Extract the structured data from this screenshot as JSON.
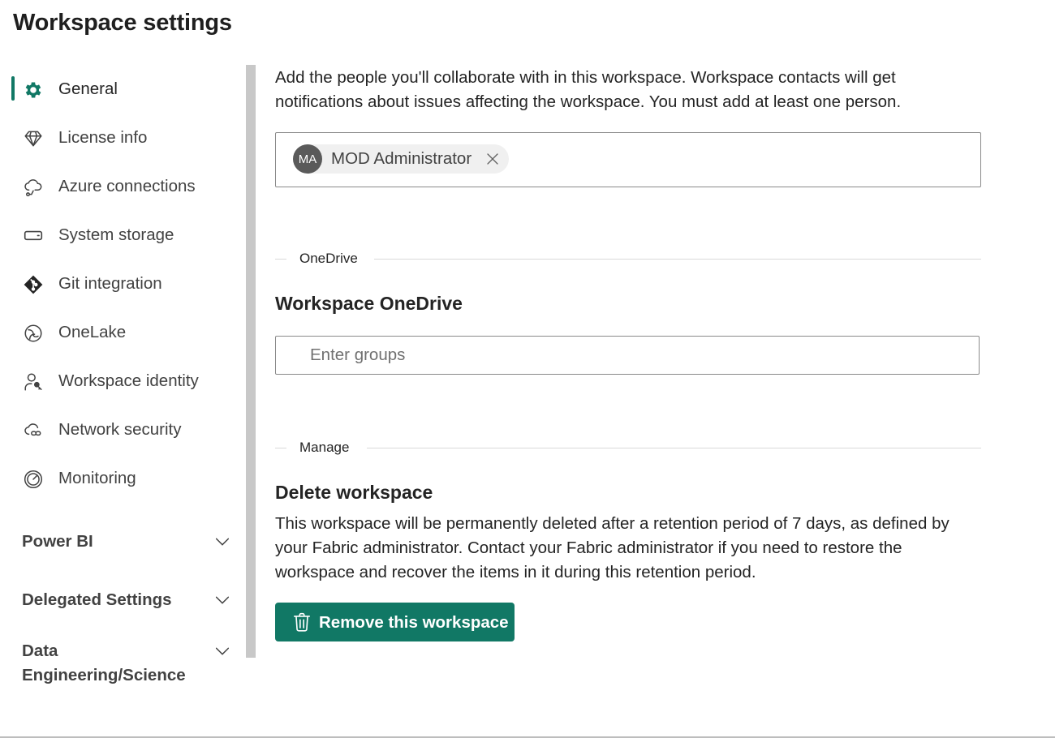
{
  "page": {
    "title": "Workspace settings"
  },
  "sidebar": {
    "items": [
      {
        "label": "General",
        "icon": "gear-icon",
        "active": true
      },
      {
        "label": "License info",
        "icon": "diamond-icon"
      },
      {
        "label": "Azure connections",
        "icon": "cloud-link-icon"
      },
      {
        "label": "System storage",
        "icon": "storage-icon"
      },
      {
        "label": "Git integration",
        "icon": "git-icon"
      },
      {
        "label": "OneLake",
        "icon": "onelake-icon"
      },
      {
        "label": "Workspace identity",
        "icon": "person-key-icon"
      },
      {
        "label": "Network security",
        "icon": "cloud-link-icon"
      },
      {
        "label": "Monitoring",
        "icon": "gauge-icon"
      }
    ],
    "groups": [
      {
        "label": "Power BI"
      },
      {
        "label": "Delegated Settings"
      },
      {
        "label": "Data Engineering/Science"
      }
    ]
  },
  "contacts": {
    "intro": "Add the people you'll collaborate with in this workspace. Workspace contacts will get notifications about issues affecting the workspace. You must add at least one person.",
    "people": [
      {
        "initials": "MA",
        "name": "MOD Administrator"
      }
    ]
  },
  "onedrive": {
    "divider_label": "OneDrive",
    "heading": "Workspace OneDrive",
    "input_placeholder": "Enter groups",
    "input_value": ""
  },
  "manage": {
    "divider_label": "Manage",
    "heading": "Delete workspace",
    "description": "This workspace will be permanently deleted after a retention period of 7 days, as defined by your Fabric administrator. Contact your Fabric administrator if you need to restore the workspace and recover the items in it during this retention period.",
    "button_label": "Remove this workspace"
  },
  "colors": {
    "accent": "#117865",
    "text": "#242424",
    "border": "#8a8a8a",
    "scrollbar": "#c8c8c8"
  }
}
